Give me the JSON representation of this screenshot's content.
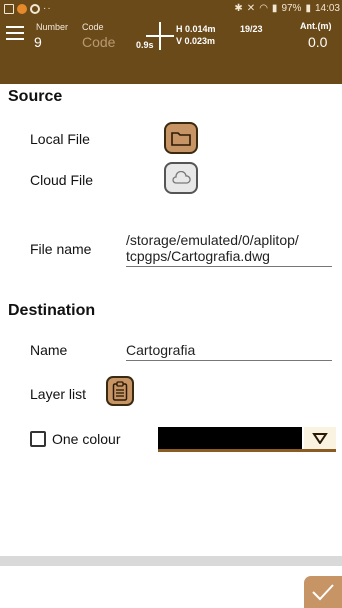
{
  "status_bar": {
    "battery": "97%",
    "time": "14:03"
  },
  "app_bar": {
    "number_label": "Number",
    "number_value": "9",
    "code_label": "Code",
    "code_value": "Code",
    "timer": "0.9s",
    "h_precision": "H 0.014m",
    "satellites": "19/23",
    "v_precision": "V 0.023m",
    "antenna_label": "Ant.(m)",
    "antenna_value": "0.0"
  },
  "source": {
    "title": "Source",
    "local_file_label": "Local File",
    "cloud_file_label": "Cloud File",
    "file_name_label": "File name",
    "file_name_value_line1": "/storage/emulated/0/aplitop/",
    "file_name_value_line2": "tcpgps/Cartografia.dwg"
  },
  "destination": {
    "title": "Destination",
    "name_label": "Name",
    "name_value": "Cartografia",
    "layer_list_label": "Layer list",
    "one_colour_label": "One colour",
    "one_colour_checked": false,
    "selected_colour": "#000000"
  },
  "colors": {
    "brand_brown": "#6b4a1a",
    "accent_tan": "#c79466"
  }
}
